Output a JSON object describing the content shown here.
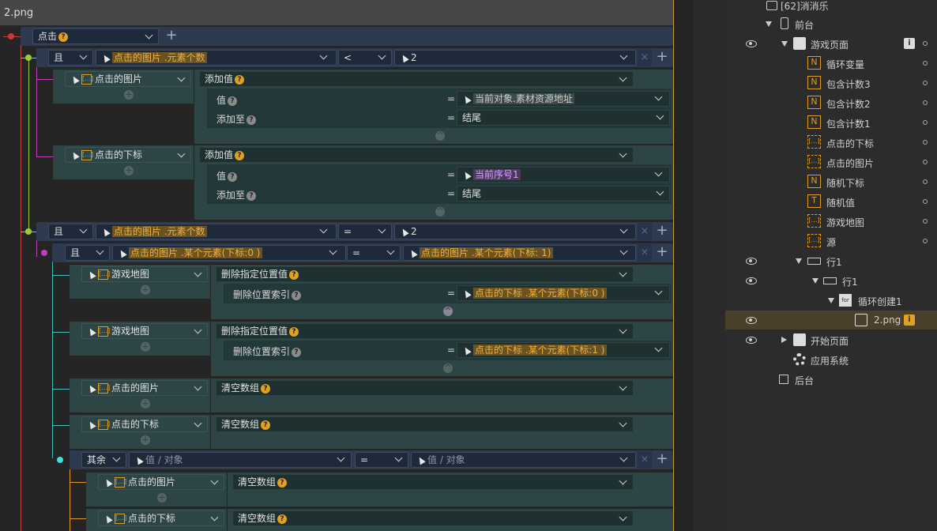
{
  "editor": {
    "title": "2.png",
    "event": {
      "trigger": "点击"
    },
    "cond1": {
      "logic": "且",
      "left": "点击的图片 .元素个数",
      "op": "<",
      "right": "2"
    },
    "block1": {
      "target": "点击的图片",
      "action": "添加值",
      "p1_label": "值",
      "p1_eq": "=",
      "p1_value": "当前对象.素材资源地址",
      "p2_label": "添加至",
      "p2_eq": "=",
      "p2_value": "结尾"
    },
    "block2": {
      "target": "点击的下标",
      "action": "添加值",
      "p1_label": "值",
      "p1_eq": "=",
      "p1_value": "当前序号1",
      "p2_label": "添加至",
      "p2_eq": "=",
      "p2_value": "结尾"
    },
    "cond2": {
      "logic": "且",
      "left": "点击的图片 .元素个数",
      "op": "=",
      "right": "2"
    },
    "cond3": {
      "logic": "且",
      "left": "点击的图片 .某个元素(下标:0 )",
      "op": "=",
      "right": "点击的图片 .某个元素(下标: 1)"
    },
    "block3": {
      "target": "游戏地图",
      "action": "删除指定位置值",
      "p1_label": "删除位置索引",
      "p1_eq": "=",
      "p1_value": "点击的下标 .某个元素(下标:0 )"
    },
    "block4": {
      "target": "游戏地图",
      "action": "删除指定位置值",
      "p1_label": "删除位置索引",
      "p1_eq": "=",
      "p1_value": "点击的下标 .某个元素(下标:1 )"
    },
    "block5": {
      "target": "点击的图片",
      "action": "清空数组"
    },
    "block6": {
      "target": "点击的下标",
      "action": "清空数组"
    },
    "cond4": {
      "logic": "其余",
      "left": "值 / 对象",
      "op": "=",
      "right": "值 / 对象"
    },
    "block7": {
      "target": "点击的图片",
      "action": "清空数组"
    },
    "block8": {
      "target": "点击的下标",
      "action": "清空数组"
    }
  },
  "tree": [
    {
      "label": "[62]消消乐",
      "icon": "game-icon",
      "indent": 0
    },
    {
      "label": "前台",
      "icon": "phone-icon",
      "indent": 1
    },
    {
      "label": "游戏页面",
      "icon": "page-icon",
      "indent": 2
    },
    {
      "label": "循环变量",
      "icon": "number-var-icon",
      "indent": 3
    },
    {
      "label": "包含计数3",
      "icon": "number-var-icon",
      "indent": 3
    },
    {
      "label": "包含计数2",
      "icon": "number-var-icon",
      "indent": 3
    },
    {
      "label": "包含计数1",
      "icon": "number-var-icon",
      "indent": 3
    },
    {
      "label": "点击的下标",
      "icon": "array-var-icon",
      "indent": 3
    },
    {
      "label": "点击的图片",
      "icon": "array-var-icon",
      "indent": 3
    },
    {
      "label": "随机下标",
      "icon": "number-var-icon",
      "indent": 3
    },
    {
      "label": "随机值",
      "icon": "text-var-icon",
      "indent": 3
    },
    {
      "label": "游戏地图",
      "icon": "array-var-icon",
      "indent": 3
    },
    {
      "label": "源",
      "icon": "array-var-icon",
      "indent": 3
    },
    {
      "label": "行1",
      "icon": "row-icon",
      "indent": 3
    },
    {
      "label": "行1",
      "icon": "row-icon",
      "indent": 4
    },
    {
      "label": "循环创建1",
      "icon": "for-loop-icon",
      "for_text": "for",
      "indent": 5
    },
    {
      "label": "2.png",
      "icon": "image-icon",
      "indent": 6
    },
    {
      "label": "开始页面",
      "icon": "page-icon",
      "indent": 2
    },
    {
      "label": "应用系统",
      "icon": "gear-icon",
      "indent": 2
    },
    {
      "label": "后台",
      "icon": "backend-icon",
      "indent": 1
    }
  ],
  "icons": {
    "param_hint": "?",
    "plus": "+",
    "close": "×",
    "info": "i",
    "for_badge": "for",
    "num_var": "N",
    "text_var": "T",
    "array_var": "[…]"
  },
  "colors": {
    "accent": "#e09b2a",
    "teal": "#2d4545",
    "nav_blue": "#2d3a4f",
    "selected": "#4a3f2a"
  }
}
